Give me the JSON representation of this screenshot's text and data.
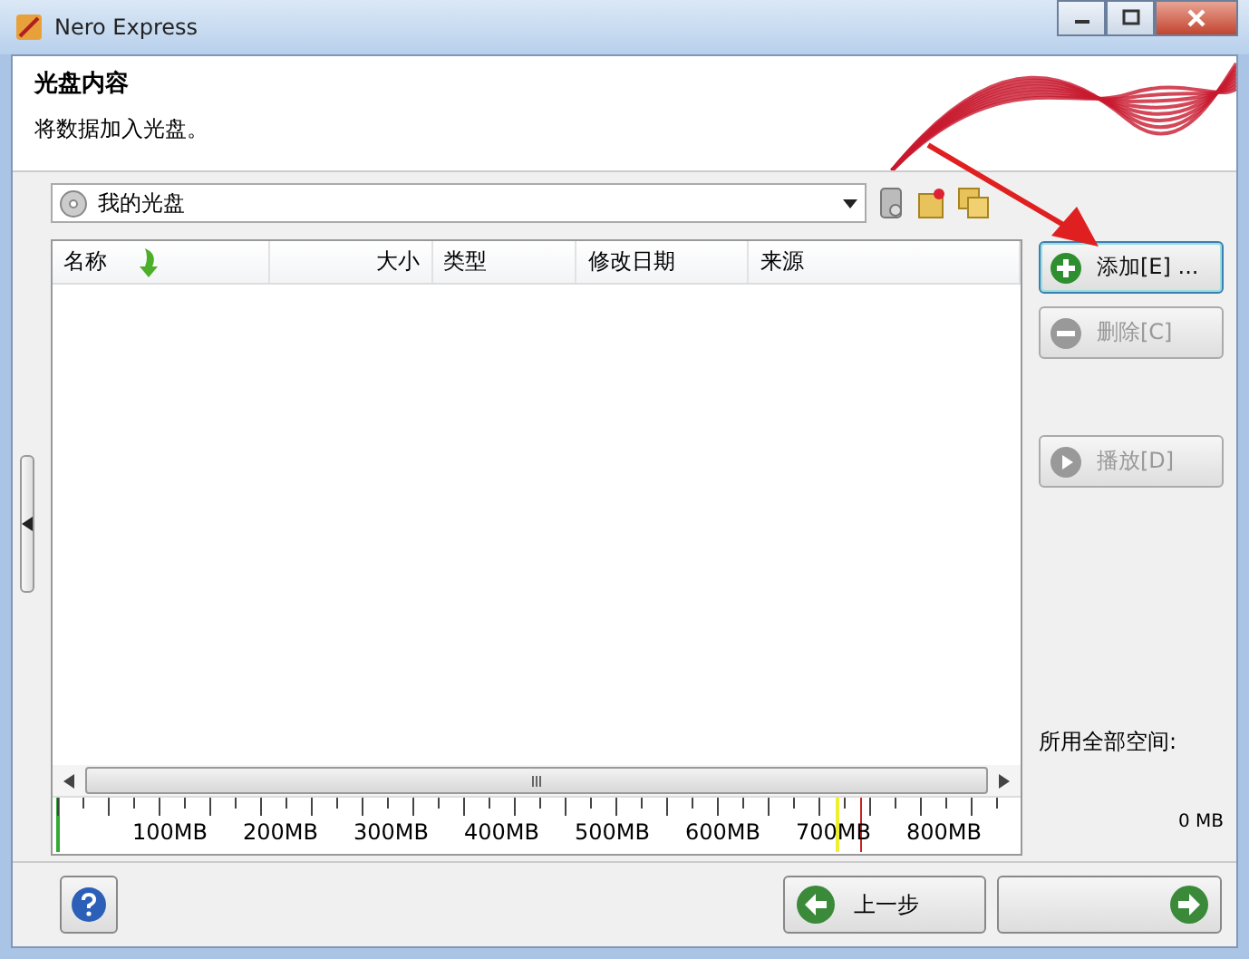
{
  "window": {
    "title": "Nero Express"
  },
  "header": {
    "title": "光盘内容",
    "subtitle": "将数据加入光盘。"
  },
  "disc_selector": {
    "value": "我的光盘"
  },
  "table": {
    "columns": [
      {
        "label": "名称"
      },
      {
        "label": "大小"
      },
      {
        "label": "类型"
      },
      {
        "label": "修改日期"
      },
      {
        "label": "来源"
      }
    ]
  },
  "ruler": {
    "labels": [
      "100MB",
      "200MB",
      "300MB",
      "400MB",
      "500MB",
      "600MB",
      "700MB",
      "800MB"
    ]
  },
  "side_buttons": [
    {
      "kind": "add",
      "label": "添加[E] ...",
      "disabled": false,
      "selected": true
    },
    {
      "kind": "delete",
      "label": "删除[C]",
      "disabled": true,
      "selected": false
    },
    {
      "kind": "play",
      "label": "播放[D]",
      "disabled": true,
      "selected": false
    }
  ],
  "space": {
    "label": "所用全部空间:",
    "value": "0 MB"
  },
  "footer": {
    "back": "上一步"
  }
}
